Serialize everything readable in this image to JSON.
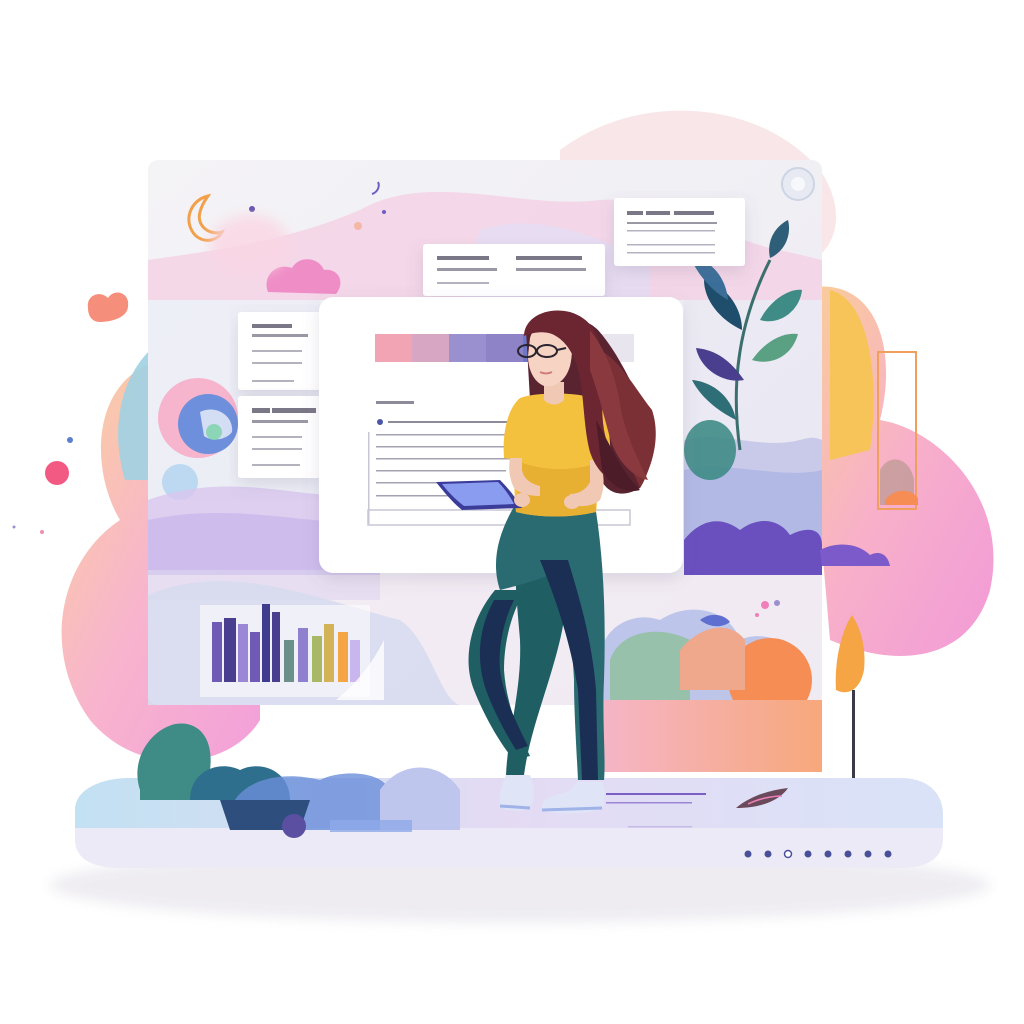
{
  "colors": {
    "background": "#ffffff",
    "panel": "#f4f3f6",
    "card": "#ffffff",
    "placeholder_line": "#8a8796",
    "accent_pink": "#f07fb9",
    "accent_orange": "#f6a545",
    "accent_purple": "#7b5fc7",
    "accent_teal": "#3f8c86",
    "accent_blue": "#7aa6e0",
    "shirt": "#f4c13f",
    "pants": "#1f5f63",
    "hair": "#5a2330",
    "base": "#eceaf6"
  },
  "palette_swatches": [
    "#f3a4b4",
    "#d7a6c2",
    "#9a8fcf",
    "#8e83c6",
    "#6f77c9",
    "#a7a4cf",
    "#e8e5ef"
  ],
  "carousel_dots": 8,
  "carousel_active_dot": 2,
  "icons": {
    "window_control": "circle-icon",
    "moon": "moon-icon",
    "cloud": "cloud-icon",
    "plant": "leaf-icon",
    "lamp": "lamp-icon",
    "tablet": "tablet-icon"
  }
}
